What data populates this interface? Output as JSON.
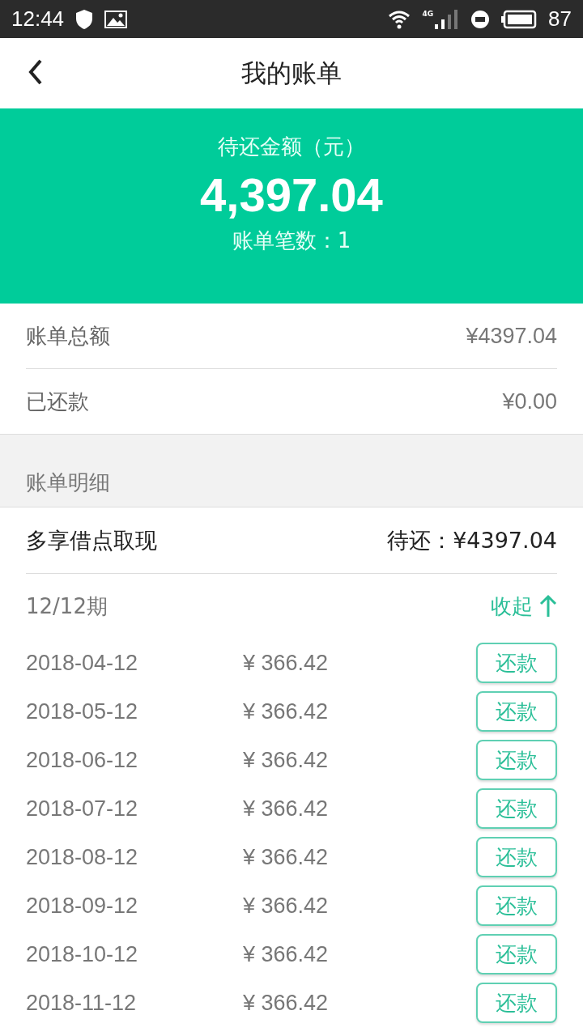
{
  "status_bar": {
    "time": "12:44",
    "network": "4G",
    "battery": "87"
  },
  "header": {
    "title": "我的账单"
  },
  "summary": {
    "label": "待还金额（元）",
    "amount": "4,397.04",
    "count": "账单笔数：1"
  },
  "totals": [
    {
      "label": "账单总额",
      "value": "¥4397.04"
    },
    {
      "label": "已还款",
      "value": "¥0.00"
    }
  ],
  "section_title": "账单明细",
  "loan": {
    "name": "多享借点取现",
    "pending": "待还：¥4397.04"
  },
  "period": {
    "label": "12/12期",
    "toggle": "收起",
    "expanded": true
  },
  "installments": [
    {
      "date": "2018-04-12",
      "amount": "¥ 366.42",
      "button": "还款"
    },
    {
      "date": "2018-05-12",
      "amount": "¥ 366.42",
      "button": "还款"
    },
    {
      "date": "2018-06-12",
      "amount": "¥ 366.42",
      "button": "还款"
    },
    {
      "date": "2018-07-12",
      "amount": "¥ 366.42",
      "button": "还款"
    },
    {
      "date": "2018-08-12",
      "amount": "¥ 366.42",
      "button": "还款"
    },
    {
      "date": "2018-09-12",
      "amount": "¥ 366.42",
      "button": "还款"
    },
    {
      "date": "2018-10-12",
      "amount": "¥ 366.42",
      "button": "还款"
    },
    {
      "date": "2018-11-12",
      "amount": "¥ 366.42",
      "button": "还款"
    }
  ]
}
